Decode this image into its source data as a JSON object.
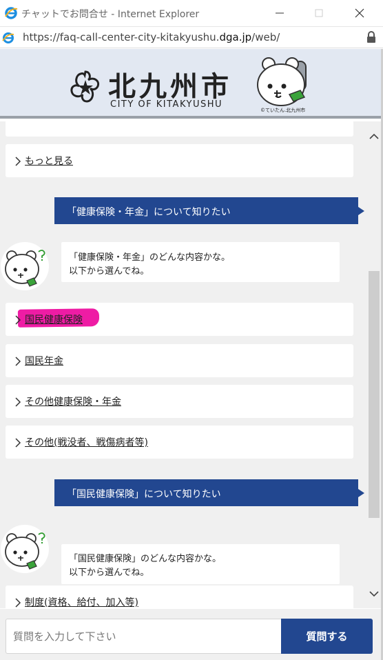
{
  "window": {
    "title": "チャットでお問合せ - Internet Explorer",
    "icons": [
      "ie-icon",
      "minimize-icon",
      "maximize-icon",
      "close-icon"
    ]
  },
  "address_bar": {
    "url_prefix": "https://faq-call-center-city-kitakyushu.",
    "url_domain": "dga.jp",
    "url_suffix": "/web/",
    "icons": [
      "page-icon",
      "lock-icon"
    ]
  },
  "header": {
    "logo_kanji": "北九州市",
    "logo_english": "CITY OF KITAKYUSHU",
    "mascot_credit": "©ていたん.北九州市"
  },
  "chat": {
    "first_choices": [
      {
        "label": "もっと見る"
      }
    ],
    "messages": [
      {
        "user": "「健康保険・年金」について知りたい",
        "bot_lines": [
          "「健康保険・年金」のどんな内容かな。",
          "以下から選んでね。"
        ],
        "choices": [
          {
            "label": "国民健康保険",
            "highlighted": true
          },
          {
            "label": "国民年金"
          },
          {
            "label": "その他健康保険・年金"
          },
          {
            "label": "その他(戦没者、戦傷病者等)"
          }
        ]
      },
      {
        "user": "「国民健康保険」について知りたい",
        "bot_lines": [
          "「国民健康保険」のどんな内容かな。",
          "以下から選んでね。"
        ],
        "choices": [
          {
            "label": "制度(資格、給付、加入等)"
          }
        ]
      }
    ]
  },
  "input": {
    "placeholder": "質問を入力して下さい",
    "submit_label": "質問する"
  },
  "colors": {
    "brand_navy": "#224790",
    "chat_background": "#f0f0f0",
    "banner_background": "#e2e8f2",
    "highlight_marker": "#ee1ca4"
  }
}
